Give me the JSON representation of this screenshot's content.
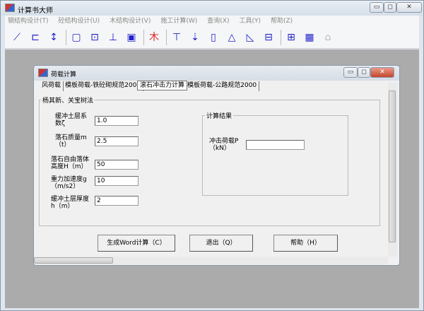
{
  "app": {
    "title": "计算书大师",
    "min": "▭",
    "max": "◻",
    "close": "✕"
  },
  "menu": [
    "钢结构设计(T)",
    "砼结构设计(U)",
    "木结构设计(V)",
    "施工计算(W)",
    "查询(X)",
    "工具(Y)",
    "帮助(Z)"
  ],
  "toolbar": [
    {
      "icon": "beam-icon",
      "glyph": "⟋"
    },
    {
      "icon": "connection-icon",
      "glyph": "⊏"
    },
    {
      "icon": "joint-icon",
      "glyph": "↕"
    },
    {
      "icon": "box-icon",
      "glyph": "▢"
    },
    {
      "icon": "column-section-icon",
      "glyph": "⊡"
    },
    {
      "icon": "foundation-icon",
      "glyph": "⊥"
    },
    {
      "icon": "square-section-icon",
      "glyph": "▣"
    },
    {
      "icon": "wood-icon",
      "glyph": "木"
    },
    {
      "icon": "pile-icon",
      "glyph": "⊤"
    },
    {
      "icon": "rock-impact-icon",
      "glyph": "⇣"
    },
    {
      "icon": "wall-icon",
      "glyph": "▯"
    },
    {
      "icon": "truss-icon",
      "glyph": "△"
    },
    {
      "icon": "retaining-icon",
      "glyph": "◺"
    },
    {
      "icon": "anchor-icon",
      "glyph": "⊟"
    },
    {
      "icon": "grid-icon",
      "glyph": "⊞"
    },
    {
      "icon": "table-icon",
      "glyph": "▦"
    },
    {
      "icon": "disabled-icon",
      "glyph": "⌂"
    }
  ],
  "dialog": {
    "title": "荷载计算",
    "tabs": [
      "风荷载",
      "模板荷载-铁砼砌规范2001",
      "滚石冲击力计算",
      "模板荷载-公路规范2000"
    ],
    "active_tab": 2,
    "group_title": "杨其新、关宝树法",
    "fields": [
      {
        "label": "缓冲土层系数ζ",
        "value": "1.0"
      },
      {
        "label": "落石质量m（t）",
        "value": "2.5"
      },
      {
        "label": "落石自由落体高度H（m）",
        "value": "50"
      },
      {
        "label": "重力加速度g（m/s2）",
        "value": "10"
      },
      {
        "label": "缓冲土层厚度h（m）",
        "value": "2"
      }
    ],
    "result_group": "计算结果",
    "result_label": "冲击荷载P（kN）",
    "result_value": "",
    "buttons": {
      "word": "生成Word计算（C）",
      "exit": "退出（Q）",
      "help": "帮助（H）"
    }
  }
}
